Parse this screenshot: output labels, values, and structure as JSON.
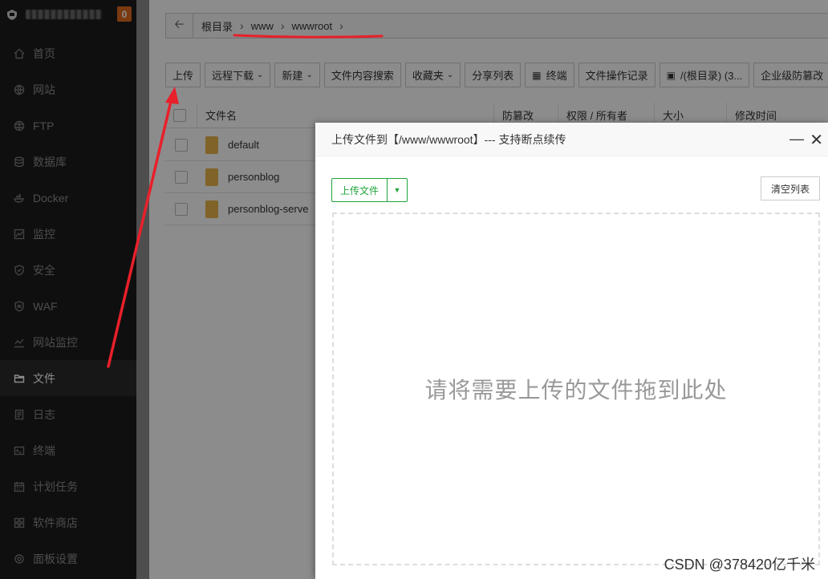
{
  "sidebar": {
    "notice_count": "0",
    "items": [
      {
        "label": "首页",
        "icon": "home-icon"
      },
      {
        "label": "网站",
        "icon": "globe-icon"
      },
      {
        "label": "FTP",
        "icon": "ftp-icon"
      },
      {
        "label": "数据库",
        "icon": "database-icon"
      },
      {
        "label": "Docker",
        "icon": "docker-icon"
      },
      {
        "label": "监控",
        "icon": "monitor-chart-icon"
      },
      {
        "label": "安全",
        "icon": "shield-icon"
      },
      {
        "label": "WAF",
        "icon": "waf-shield-icon"
      },
      {
        "label": "网站监控",
        "icon": "site-monitor-icon"
      },
      {
        "label": "文件",
        "icon": "folder-icon"
      },
      {
        "label": "日志",
        "icon": "log-icon"
      },
      {
        "label": "终端",
        "icon": "terminal-icon"
      },
      {
        "label": "计划任务",
        "icon": "calendar-icon"
      },
      {
        "label": "软件商店",
        "icon": "apps-icon"
      },
      {
        "label": "面板设置",
        "icon": "settings-icon"
      }
    ]
  },
  "breadcrumb": [
    "根目录",
    "www",
    "wwwroot"
  ],
  "toolbar": {
    "upload": "上传",
    "remote_download": "远程下载",
    "new": "新建",
    "content_search": "文件内容搜索",
    "favorites": "收藏夹",
    "share_list": "分享列表",
    "terminal": "终端",
    "op_log": "文件操作记录",
    "disk": "/(根目录) (3...",
    "enterprise": "企业级防篡改"
  },
  "table": {
    "headers": [
      "文件名",
      "防篡改",
      "权限 / 所有者",
      "大小",
      "修改时间"
    ],
    "rows": [
      "default",
      "personblog",
      "personblog-serve"
    ]
  },
  "dialog": {
    "title": "上传文件到【/www/wwwroot】--- 支持断点续传",
    "upload_button": "上传文件",
    "clear_button": "清空列表",
    "drop_hint": "请将需要上传的文件拖到此处"
  },
  "watermark": "CSDN @378420亿千米",
  "colors": {
    "accent_green": "#20a53a",
    "annotation_red": "#e8202a",
    "badge_orange": "#e06a1f"
  }
}
